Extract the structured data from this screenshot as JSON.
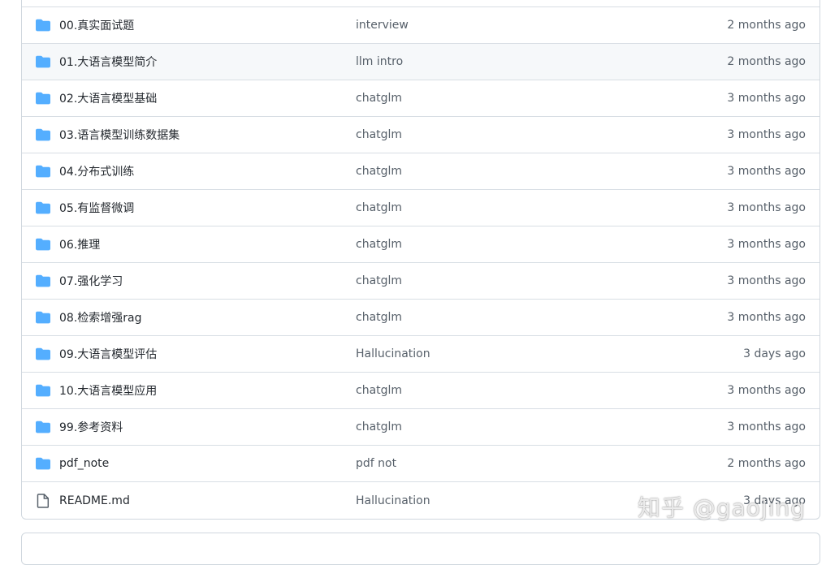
{
  "colors": {
    "folder_icon": "#54aeff",
    "file_icon": "#57606a",
    "border": "#d0d7de",
    "hover_row": "#f6f8fa",
    "muted_text": "#57606a"
  },
  "files": [
    {
      "name": "00.真实面试题",
      "commit": "interview",
      "age": "2 months ago",
      "icon": "folder-icon"
    },
    {
      "name": "01.大语言模型简介",
      "commit": "llm intro",
      "age": "2 months ago",
      "icon": "folder-icon"
    },
    {
      "name": "02.大语言模型基础",
      "commit": "chatglm",
      "age": "3 months ago",
      "icon": "folder-icon"
    },
    {
      "name": "03.语言模型训练数据集",
      "commit": "chatglm",
      "age": "3 months ago",
      "icon": "folder-icon"
    },
    {
      "name": "04.分布式训练",
      "commit": "chatglm",
      "age": "3 months ago",
      "icon": "folder-icon"
    },
    {
      "name": "05.有监督微调",
      "commit": "chatglm",
      "age": "3 months ago",
      "icon": "folder-icon"
    },
    {
      "name": "06.推理",
      "commit": "chatglm",
      "age": "3 months ago",
      "icon": "folder-icon"
    },
    {
      "name": "07.强化学习",
      "commit": "chatglm",
      "age": "3 months ago",
      "icon": "folder-icon"
    },
    {
      "name": "08.检索增强rag",
      "commit": "chatglm",
      "age": "3 months ago",
      "icon": "folder-icon"
    },
    {
      "name": "09.大语言模型评估",
      "commit": "Hallucination",
      "age": "3 days ago",
      "icon": "folder-icon"
    },
    {
      "name": "10.大语言模型应用",
      "commit": "chatglm",
      "age": "3 months ago",
      "icon": "folder-icon"
    },
    {
      "name": "99.参考资料",
      "commit": "chatglm",
      "age": "3 months ago",
      "icon": "folder-icon"
    },
    {
      "name": "pdf_note",
      "commit": "pdf not",
      "age": "2 months ago",
      "icon": "folder-icon"
    },
    {
      "name": "README.md",
      "commit": "Hallucination",
      "age": "3 days ago",
      "icon": "file-icon"
    }
  ],
  "watermark": "知乎 @gaojing"
}
